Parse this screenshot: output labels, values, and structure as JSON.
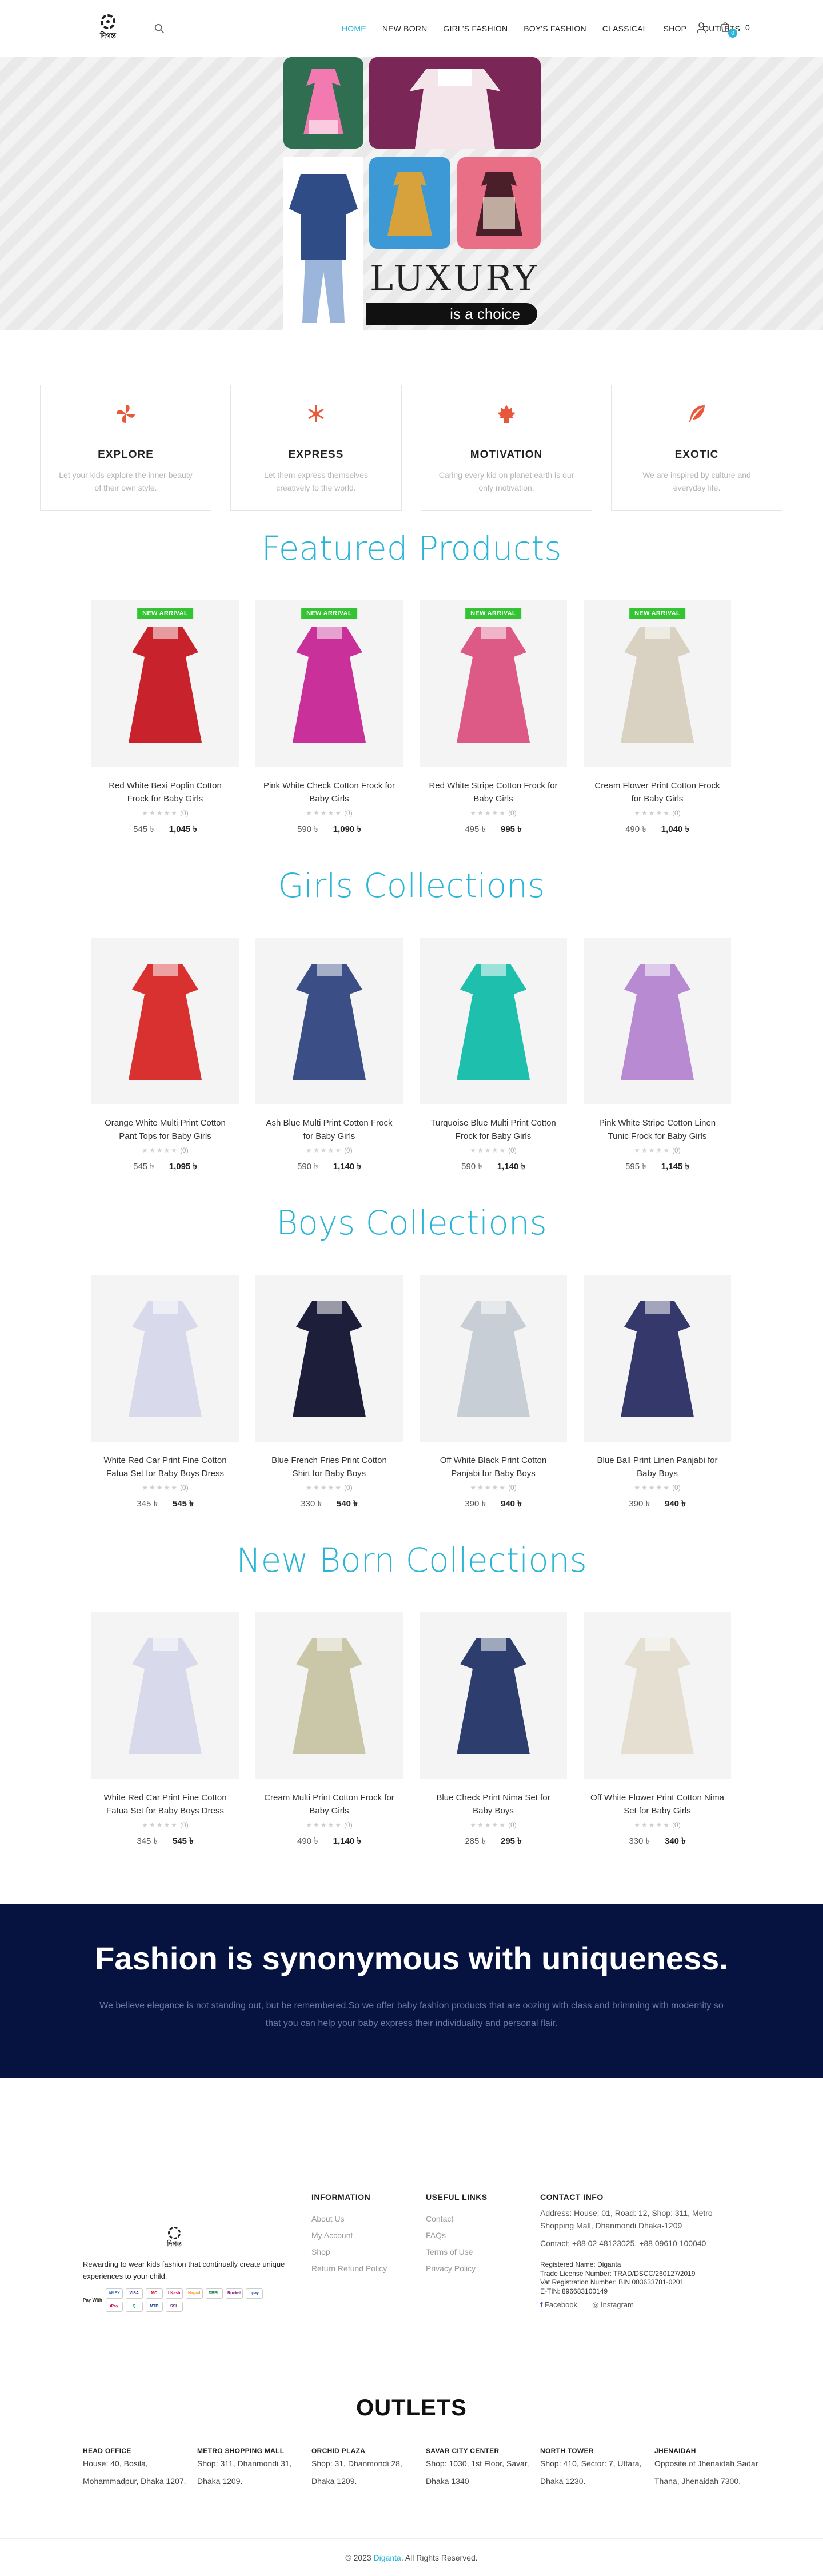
{
  "header": {
    "logo_text": "দিগন্ত",
    "nav": [
      "HOME",
      "NEW BORN",
      "GIRL'S FASHION",
      "BOY'S FASHION",
      "CLASSICAL",
      "SHOP",
      "OUTLETS"
    ],
    "cart_count": "0",
    "cart_total": "0"
  },
  "hero": {
    "line1": "LUXURY",
    "line2": "is a choice"
  },
  "features": [
    {
      "title": "EXPLORE",
      "text": "Let your kids explore the inner beauty of their own style.",
      "icon": "pinwheel-icon"
    },
    {
      "title": "EXPRESS",
      "text": "Let them express themselves creatively to the world.",
      "icon": "snowflake-icon"
    },
    {
      "title": "MOTIVATION",
      "text": "Caring every kid on planet earth is our only motivation.",
      "icon": "leaf-icon"
    },
    {
      "title": "EXOTIC",
      "text": "We are inspired by culture and everyday life.",
      "icon": "feather-icon"
    }
  ],
  "sections": [
    {
      "title": "Featured Products",
      "products": [
        {
          "name": "Red White Bexi Poplin Cotton Frock for Baby Girls",
          "old": "545",
          "new": "1,045",
          "badge": "NEW ARRIVAL",
          "color": "#c8232c"
        },
        {
          "name": "Pink White Check Cotton Frock for Baby Girls",
          "old": "590",
          "new": "1,090",
          "badge": "NEW ARRIVAL",
          "color": "#c9309a"
        },
        {
          "name": "Red White Stripe Cotton Frock for Baby Girls",
          "old": "495",
          "new": "995",
          "badge": "NEW ARRIVAL",
          "color": "#de5a86"
        },
        {
          "name": "Cream Flower Print Cotton Frock for Baby Girls",
          "old": "490",
          "new": "1,040",
          "badge": "NEW ARRIVAL",
          "color": "#d9d2c2"
        }
      ]
    },
    {
      "title": "Girls Collections",
      "products": [
        {
          "name": "Orange White Multi Print Cotton Pant Tops for Baby Girls",
          "old": "545",
          "new": "1,095",
          "badge": "",
          "color": "#d93030"
        },
        {
          "name": "Ash Blue Multi Print Cotton Frock for Baby Girls",
          "old": "590",
          "new": "1,140",
          "badge": "",
          "color": "#3b4f86"
        },
        {
          "name": "Turquoise Blue Multi Print Cotton Frock for Baby Girls",
          "old": "590",
          "new": "1,140",
          "badge": "",
          "color": "#1fbfae"
        },
        {
          "name": "Pink White Stripe Cotton Linen Tunic Frock for Baby Girls",
          "old": "595",
          "new": "1,145",
          "badge": "",
          "color": "#b78ad1"
        }
      ]
    },
    {
      "title": "Boys Collections",
      "products": [
        {
          "name": "White Red Car Print Fine Cotton Fatua Set for Baby Boys Dress",
          "old": "345",
          "new": "545",
          "badge": "",
          "color": "#d9d9ec"
        },
        {
          "name": "Blue French Fries Print Cotton Shirt for Baby Boys",
          "old": "330",
          "new": "540",
          "badge": "",
          "color": "#1d1f3a"
        },
        {
          "name": "Off White Black Print Cotton Panjabi for Baby Boys",
          "old": "390",
          "new": "940",
          "badge": "",
          "color": "#c8ced6"
        },
        {
          "name": "Blue Ball Print Linen Panjabi for Baby Boys",
          "old": "390",
          "new": "940",
          "badge": "",
          "color": "#35386a"
        }
      ]
    },
    {
      "title": "New Born Collections",
      "products": [
        {
          "name": "White Red Car Print Fine Cotton Fatua Set for Baby Boys Dress",
          "old": "345",
          "new": "545",
          "badge": "",
          "color": "#d9d9ec"
        },
        {
          "name": "Cream Multi Print Cotton Frock for Baby Girls",
          "old": "490",
          "new": "1,140",
          "badge": "",
          "color": "#c9c7a8"
        },
        {
          "name": "Blue Check Print Nima Set for Baby Boys",
          "old": "285",
          "new": "295",
          "badge": "",
          "color": "#2c3d6e"
        },
        {
          "name": "Off White Flower Print Cotton Nima Set for Baby Girls",
          "old": "330",
          "new": "340",
          "badge": "",
          "color": "#e5dfd2"
        }
      ]
    }
  ],
  "banner": {
    "title": "Fashion is synonymous with uniqueness.",
    "text": "We believe elegance is not standing out, but be remembered.So we offer baby fashion products that are oozing with class and brimming with modernity so that you can help your baby express their individuality and personal flair."
  },
  "footer": {
    "about": "Rewarding to wear kids fashion that continually create unique experiences to your child.",
    "info_title": "INFORMATION",
    "info": [
      "About Us",
      "My Account",
      "Shop",
      "Return Refund Policy"
    ],
    "useful_title": "USEFUL LINKS",
    "useful": [
      "Contact",
      "FAQs",
      "Terms of Use",
      "Privacy Policy"
    ],
    "contact_title": "CONTACT INFO",
    "address": "Address: House: 01, Road: 12, Shop: 311, Metro Shopping Mall, Dhanmondi Dhaka-1209",
    "phone": "Contact: +88 02 48123025, +88 09610 100040",
    "legal": [
      "Registered Name: Diganta",
      "Trade License Number: TRAD/DSCC/260127/2019",
      "Vat Registration Number: BIN 003633781-0201",
      "E-TIN: 896683100149"
    ],
    "social": [
      "Facebook",
      "Instagram"
    ],
    "pay_label": "Pay With",
    "pay": [
      "AMEX",
      "VISA",
      "MC",
      "bKash",
      "Nagad",
      "DBBL",
      "Rocket",
      "upay",
      "iPay",
      "Q",
      "MTB",
      "SSL"
    ]
  },
  "outlets": {
    "title": "OUTLETS",
    "list": [
      {
        "name": "HEAD OFFICE",
        "addr": "House: 40, Bosila, Mohammadpur, Dhaka 1207."
      },
      {
        "name": "METRO SHOPPING MALL",
        "addr": "Shop: 311, Dhanmondi 31, Dhaka 1209."
      },
      {
        "name": "ORCHID PLAZA",
        "addr": "Shop: 31, Dhanmondi 28, Dhaka 1209."
      },
      {
        "name": "SAVAR CITY CENTER",
        "addr": "Shop: 1030, 1st Floor, Savar, Dhaka 1340"
      },
      {
        "name": "NORTH TOWER",
        "addr": "Shop: 410, Sector: 7, Uttara, Dhaka 1230."
      },
      {
        "name": "JHENAIDAH",
        "addr": "Opposite of Jhenaidah Sadar Thana, Jhenaidah 7300."
      }
    ]
  },
  "copyright": {
    "pre": "© 2023 ",
    "link": "Diganta",
    "post": ". All Rights Reserved."
  }
}
